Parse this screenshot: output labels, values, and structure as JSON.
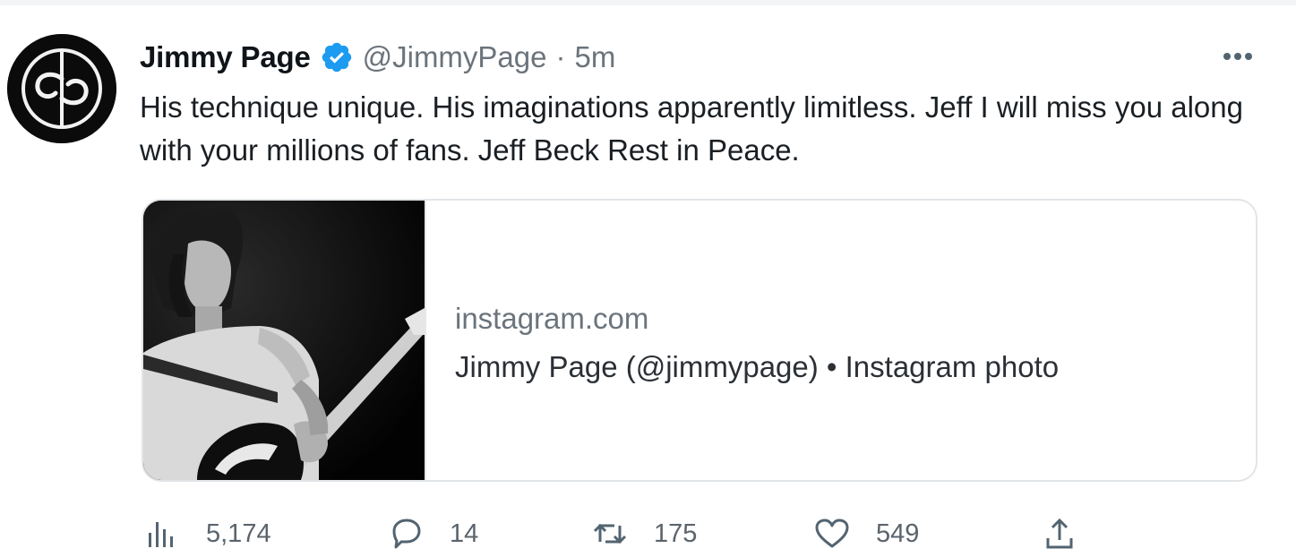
{
  "tweet": {
    "display_name": "Jimmy Page",
    "handle": "@JimmyPage",
    "separator": "·",
    "time": "5m",
    "text": "His technique unique. His imaginations apparently limitless. Jeff I will miss you along with your millions of fans. Jeff Beck Rest in Peace.",
    "avatar_icon": "jp-monogram-logo",
    "verified_icon": "verified-badge-icon",
    "more_icon": "more-dots-icon"
  },
  "card": {
    "domain": "instagram.com",
    "title": "Jimmy Page (@jimmypage) • Instagram photo",
    "photo": "black-and-white-guitarist-photo"
  },
  "actions": {
    "views": {
      "icon": "views-chart-icon",
      "count": "5,174"
    },
    "replies": {
      "icon": "reply-bubble-icon",
      "count": "14"
    },
    "retweets": {
      "icon": "retweet-icon",
      "count": "175"
    },
    "likes": {
      "icon": "heart-icon",
      "count": "549"
    },
    "share": {
      "icon": "share-upload-icon"
    }
  },
  "colors": {
    "text_primary": "#0f1419",
    "text_secondary": "#6b747c",
    "verified_blue": "#1d9bf0",
    "card_border": "#e2e5e8"
  }
}
